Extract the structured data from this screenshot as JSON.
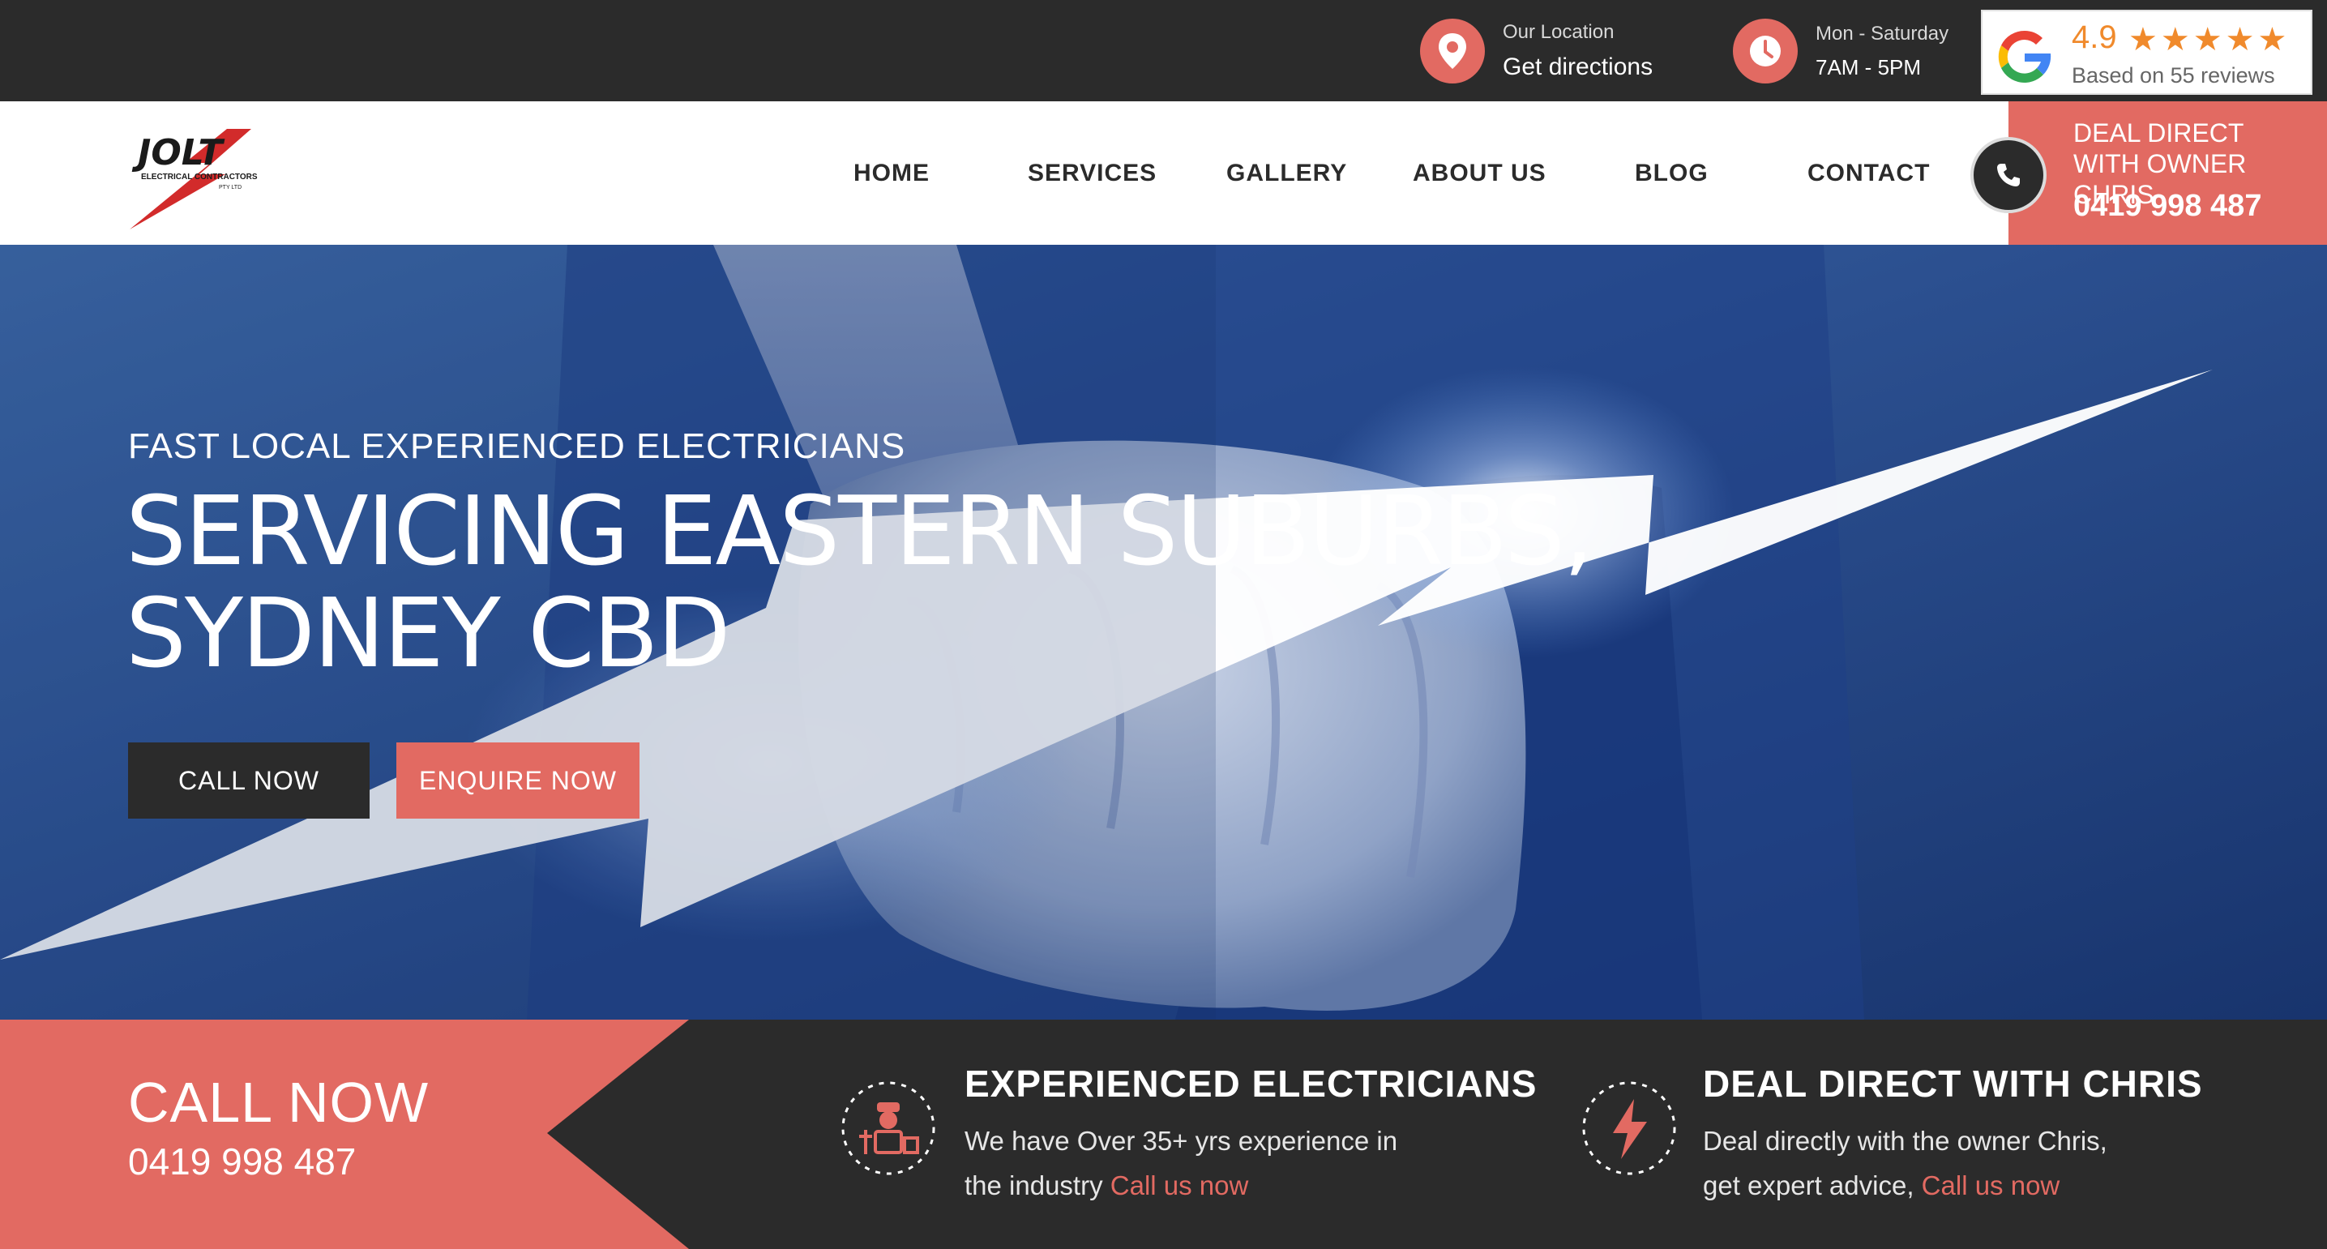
{
  "topbar": {
    "location_label": "Our Location",
    "location_value": "Get directions",
    "hours_label": "Mon - Saturday",
    "hours_value": "7AM - 5PM",
    "review_rating": "4.9",
    "review_stars": "★★★★★",
    "review_count_text": "Based on 55 reviews",
    "star_rating_value": 4.9
  },
  "nav": {
    "logo_text": "JOLT",
    "logo_subtext": "ELECTRICAL CONTRACTORS",
    "logo_fine": "PTY LTD",
    "items": [
      "HOME",
      "SERVICES",
      "GALLERY",
      "ABOUT US",
      "BLOG",
      "CONTACT"
    ],
    "deal_line1": "DEAL DIRECT",
    "deal_line2": "WITH OWNER CHRIS",
    "deal_phone": "0419 998 487"
  },
  "hero": {
    "kicker": "FAST LOCAL EXPERIENCED ELECTRICIANS",
    "headline_line1": "SERVICING EASTERN SUBURBS,",
    "headline_line2": "SYDNEY CBD",
    "call_button": "CALL NOW",
    "enquire_button": "ENQUIRE NOW"
  },
  "strip": {
    "call_title": "CALL NOW",
    "call_phone": "0419 998 487",
    "feature1_title": "EXPERIENCED ELECTRICIANS",
    "feature1_text": "We have Over 35+ yrs experience in",
    "feature1_text2": "the industry",
    "feature1_link": "Call us now",
    "feature2_title": "DEAL DIRECT WITH CHRIS",
    "feature2_text": "Deal directly with the owner Chris,",
    "feature2_text2": "get expert advice,",
    "feature2_link": "Call us now"
  },
  "icons": {
    "location": "map-pin-icon",
    "hours": "clock-icon",
    "review": "google-g-icon",
    "phone": "phone-icon",
    "feature1": "electrician-icon",
    "feature2": "lightning-bolt-icon"
  },
  "colors": {
    "accent": "#e26a62",
    "dark": "#2b2b2b",
    "hero_blue": "#2b4f8f",
    "star": "#f08a2c"
  }
}
